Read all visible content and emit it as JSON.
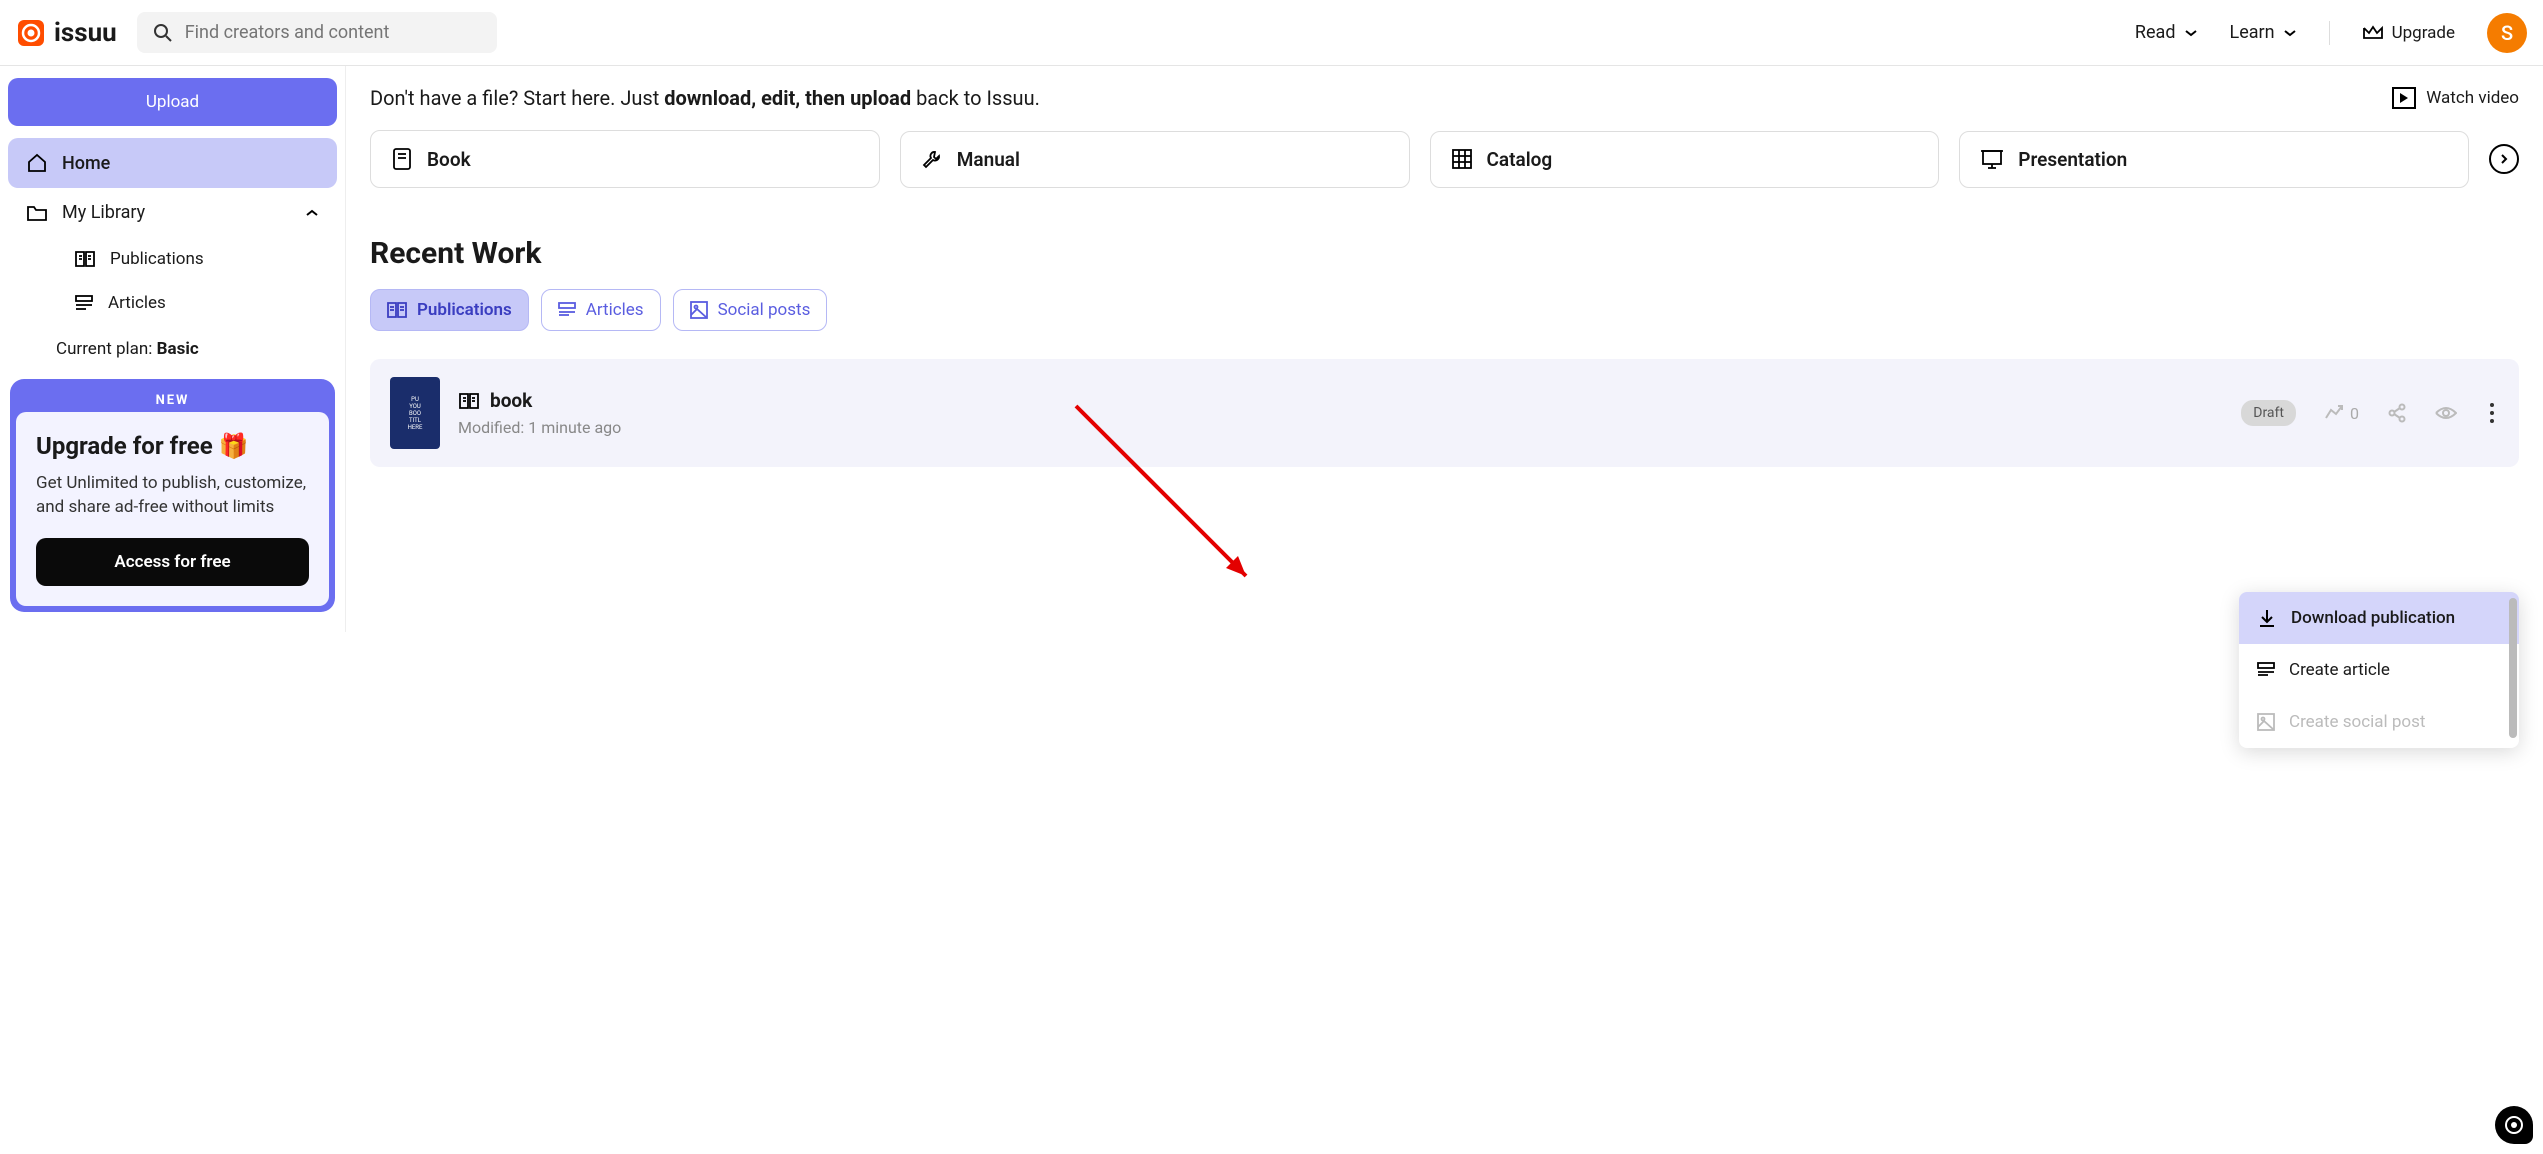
{
  "header": {
    "logo_text": "issuu",
    "search_placeholder": "Find creators and content",
    "nav": {
      "read": "Read",
      "learn": "Learn"
    },
    "upgrade": "Upgrade",
    "avatar_initial": "S"
  },
  "sidebar": {
    "upload": "Upload",
    "items": {
      "home": "Home",
      "my_library": "My Library",
      "publications": "Publications",
      "articles": "Articles"
    },
    "plan_prefix": "Current plan: ",
    "plan_value": "Basic",
    "promo": {
      "new": "NEW",
      "title": "Upgrade for free 🎁",
      "desc": "Get Unlimited to publish, customize, and share ad-free without limits",
      "cta": "Access for free"
    }
  },
  "main": {
    "hero_plain_1": "Don't have a file? Start here. Just ",
    "hero_bold": "download, edit, then upload",
    "hero_plain_2": " back to Issuu.",
    "watch_video": "Watch video",
    "templates": {
      "book": "Book",
      "manual": "Manual",
      "catalog": "Catalog",
      "presentation": "Presentation"
    },
    "recent_title": "Recent Work",
    "filters": {
      "publications": "Publications",
      "articles": "Articles",
      "social_posts": "Social posts"
    },
    "work": {
      "title": "book",
      "modified": "Modified: 1 minute ago",
      "badge": "Draft",
      "stat_count": "0"
    },
    "dropdown": {
      "download": "Download publication",
      "create_article": "Create article",
      "create_social": "Create social post"
    }
  }
}
